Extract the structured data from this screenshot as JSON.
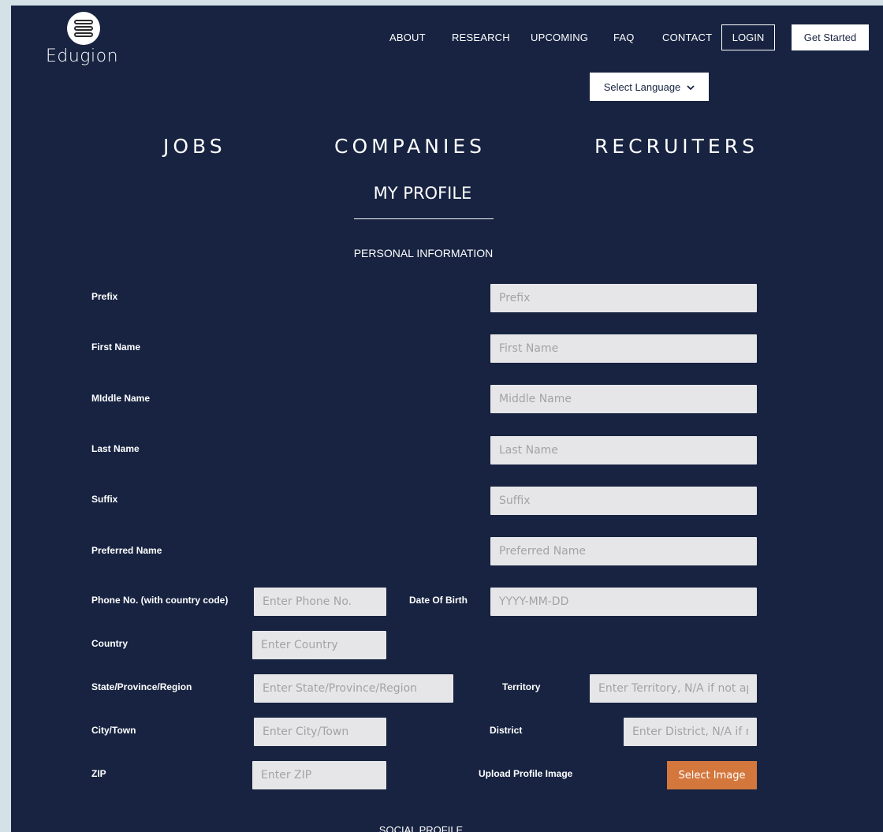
{
  "brand": {
    "name": "Edugion"
  },
  "nav": {
    "about": "ABOUT",
    "research": "RESEARCH",
    "upcoming": "UPCOMING",
    "faq": "FAQ",
    "contact": "CONTACT",
    "login": "LOGIN",
    "get_started": "Get Started"
  },
  "language": {
    "label": "Select Language",
    "icon": "chevron-down-icon"
  },
  "main_nav": {
    "jobs": "JOBS",
    "companies": "COMPANIES",
    "recruiters": "RECRUITERS"
  },
  "page_title": "MY PROFILE",
  "section_personal": "PERSONAL INFORMATION",
  "section_social": "SOCIAL PROFILE",
  "fields": {
    "prefix": {
      "label": "Prefix",
      "placeholder": "Prefix"
    },
    "first_name": {
      "label": "First Name",
      "placeholder": "First Name"
    },
    "middle_name": {
      "label": "MIddle Name",
      "placeholder": "Middle Name"
    },
    "last_name": {
      "label": "Last Name",
      "placeholder": "Last Name"
    },
    "suffix": {
      "label": "Suffix",
      "placeholder": "Suffix"
    },
    "preferred_name": {
      "label": "Preferred Name",
      "placeholder": "Preferred Name"
    },
    "phone": {
      "label": "Phone No. (with country code)",
      "placeholder": "Enter Phone No."
    },
    "dob": {
      "label": "Date Of Birth",
      "placeholder": "YYYY-MM-DD"
    },
    "country": {
      "label": "Country",
      "placeholder": "Enter Country"
    },
    "state": {
      "label": "State/Province/Region",
      "placeholder": "Enter State/Province/Region"
    },
    "territory": {
      "label": "Territory",
      "placeholder": "Enter Territory, N/A if not applicable"
    },
    "city": {
      "label": "City/Town",
      "placeholder": "Enter City/Town"
    },
    "district": {
      "label": "District",
      "placeholder": "Enter District, N/A if not applicable"
    },
    "zip": {
      "label": "ZIP",
      "placeholder": "Enter ZIP"
    },
    "profile_image": {
      "label": "Upload Profile Image",
      "button": "Select Image"
    }
  },
  "colors": {
    "page_bg": "#172341",
    "outer_bg": "#d4e2e8",
    "input_bg": "#e6e6e8",
    "accent_button": "#d4773d"
  }
}
